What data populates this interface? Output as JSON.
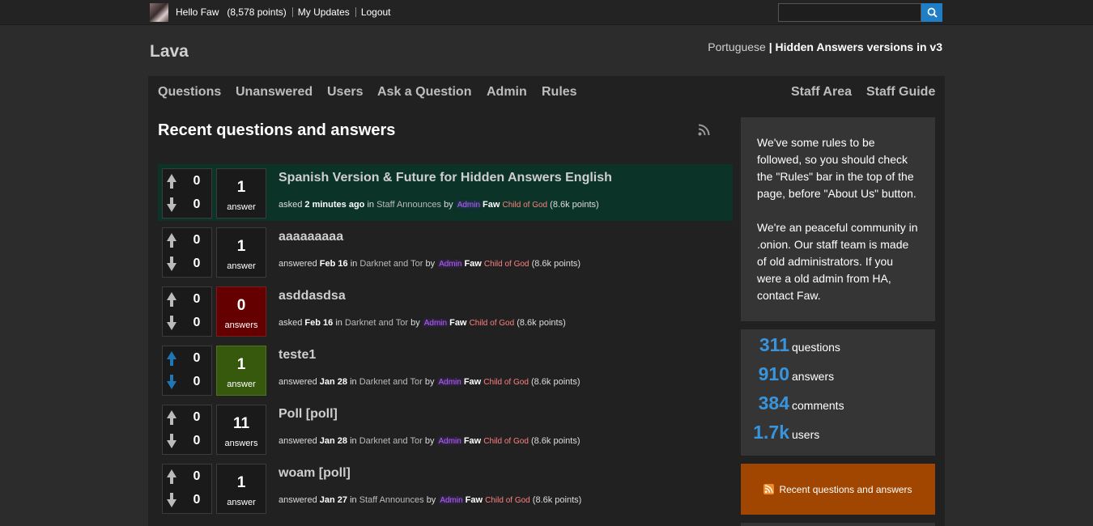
{
  "topbar": {
    "greeting": "Hello",
    "username": "Faw",
    "points": "(8,578 points)",
    "my_updates": "My Updates",
    "logout": "Logout",
    "search_placeholder": ""
  },
  "site": {
    "title": "Lava",
    "lang_link": "Portuguese",
    "lang_sep": " | ",
    "version_link": "Hidden Answers versions in v3"
  },
  "nav": {
    "left": [
      "Questions",
      "Unanswered",
      "Users",
      "Ask a Question",
      "Admin",
      "Rules"
    ],
    "right": [
      "Staff Area",
      "Staff Guide"
    ]
  },
  "heading": "Recent questions and answers",
  "questions": [
    {
      "up": "0",
      "down": "0",
      "answers": "1",
      "answers_label": "answer",
      "title": "Spanish Version & Future for Hidden Answers English",
      "action": "asked",
      "when": "2 minutes ago",
      "in": "in",
      "category": "Staff Announces",
      "by": "by",
      "badge": "Admin",
      "user": "Faw",
      "user_title": "Child of God",
      "points": "(8.6k points)",
      "highlight": true
    },
    {
      "up": "0",
      "down": "0",
      "answers": "1",
      "answers_label": "answer",
      "title": "aaaaaaaaa",
      "action": "answered",
      "when": "Feb 16",
      "in": "in",
      "category": "Darknet and Tor",
      "by": "by",
      "badge": "Admin",
      "user": "Faw",
      "user_title": "Child of God",
      "points": "(8.6k points)"
    },
    {
      "up": "0",
      "down": "0",
      "answers": "0",
      "answers_label": "answers",
      "title": "asddasdsa",
      "action": "asked",
      "when": "Feb 16",
      "in": "in",
      "category": "Darknet and Tor",
      "by": "by",
      "badge": "Admin",
      "user": "Faw",
      "user_title": "Child of God",
      "points": "(8.6k points)"
    },
    {
      "up": "0",
      "down": "0",
      "answers": "1",
      "answers_label": "answer",
      "title": "teste1",
      "action": "answered",
      "when": "Jan 28",
      "in": "in",
      "category": "Darknet and Tor",
      "by": "by",
      "badge": "Admin",
      "user": "Faw",
      "user_title": "Child of God",
      "points": "(8.6k points)"
    },
    {
      "up": "0",
      "down": "0",
      "answers": "11",
      "answers_label": "answers",
      "title": "Poll [poll]",
      "action": "answered",
      "when": "Jan 28",
      "in": "in",
      "category": "Darknet and Tor",
      "by": "by",
      "badge": "Admin",
      "user": "Faw",
      "user_title": "Child of God",
      "points": "(8.6k points)"
    },
    {
      "up": "0",
      "down": "0",
      "answers": "1",
      "answers_label": "answer",
      "title": "woam [poll]",
      "action": "answered",
      "when": "Jan 27",
      "in": "in",
      "category": "Staff Announces",
      "by": "by",
      "badge": "Admin",
      "user": "Faw",
      "user_title": "Child of God",
      "points": "(8.6k points)"
    }
  ],
  "sidebar": {
    "rules_p1": "We've some rules to be followed, so you should check the \"Rules\" bar in the top of the page, before \"About Us\" button.",
    "rules_p2": "We're an peaceful community in .onion. Our staff team is made of old administrators. If you were a old admin from HA, contact Faw.",
    "stats": [
      {
        "num": "311",
        "label": "questions"
      },
      {
        "num": "910",
        "label": "answers"
      },
      {
        "num": "384",
        "label": "comments"
      },
      {
        "num": "1.7k",
        "label": "users"
      }
    ],
    "rss_label": "Recent questions and answers"
  },
  "colors": {
    "accent": "#3994dc",
    "highlight_row": "#0b3327",
    "zero_answers": "#650000",
    "selected_answer": "#36590d",
    "rss_orange": "#a14600",
    "admin_badge": "#b25ff0",
    "user_title": "#ff8080"
  }
}
